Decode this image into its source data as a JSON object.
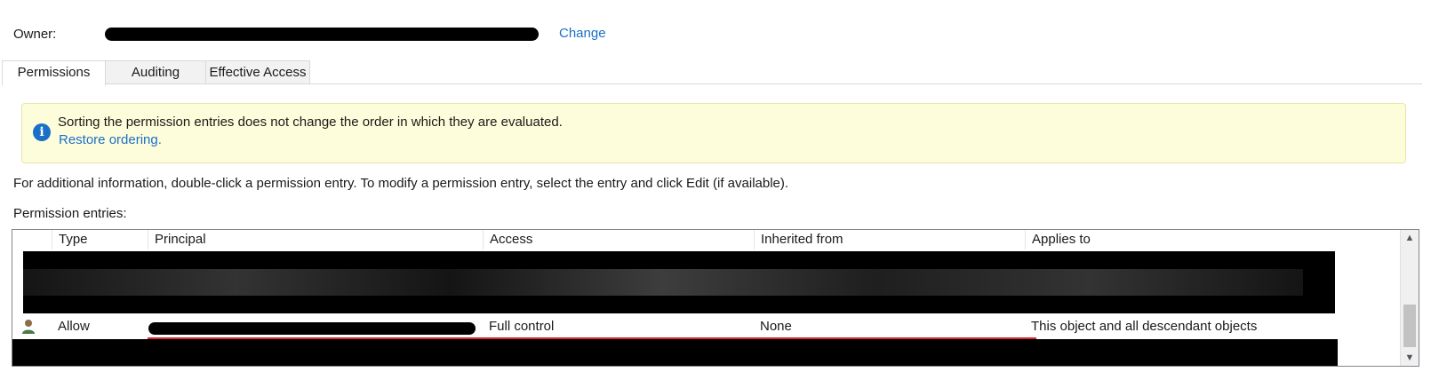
{
  "owner": {
    "label": "Owner:",
    "change_label": "Change"
  },
  "tabs": [
    {
      "label": "Permissions",
      "active": true
    },
    {
      "label": "Auditing",
      "active": false
    },
    {
      "label": "Effective Access",
      "active": false
    }
  ],
  "info": {
    "icon": "info-icon",
    "message": "Sorting the permission entries does not change the order in which they are evaluated.",
    "link": "Restore ordering."
  },
  "additional_info": "For additional information, double-click a permission entry. To modify a permission entry, select the entry and click Edit (if available).",
  "entries_label": "Permission entries:",
  "columns": [
    "Type",
    "Principal",
    "Access",
    "Inherited from",
    "Applies to"
  ],
  "selected_row": {
    "type": "Allow",
    "access": "Full control",
    "inherited_from": "None",
    "applies_to": "This object and all descendant objects"
  },
  "colors": {
    "link": "#1a6fc8",
    "info_bg": "#fdfddb",
    "selection_underline": "#d8262e"
  }
}
